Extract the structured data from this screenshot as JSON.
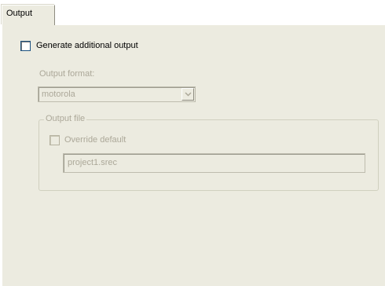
{
  "tabs": [
    {
      "label": "Output",
      "selected": true
    }
  ],
  "output": {
    "generate_label": "Generate additional output",
    "generate_checked": false,
    "format_label": "Output format:",
    "format_value": "motorola",
    "file_group_label": "Output file",
    "override_label": "Override default",
    "override_checked": false,
    "file_value": "project1.srec"
  },
  "colors": {
    "panel_background": "#ecebe0",
    "disabled_text": "#aca899"
  }
}
